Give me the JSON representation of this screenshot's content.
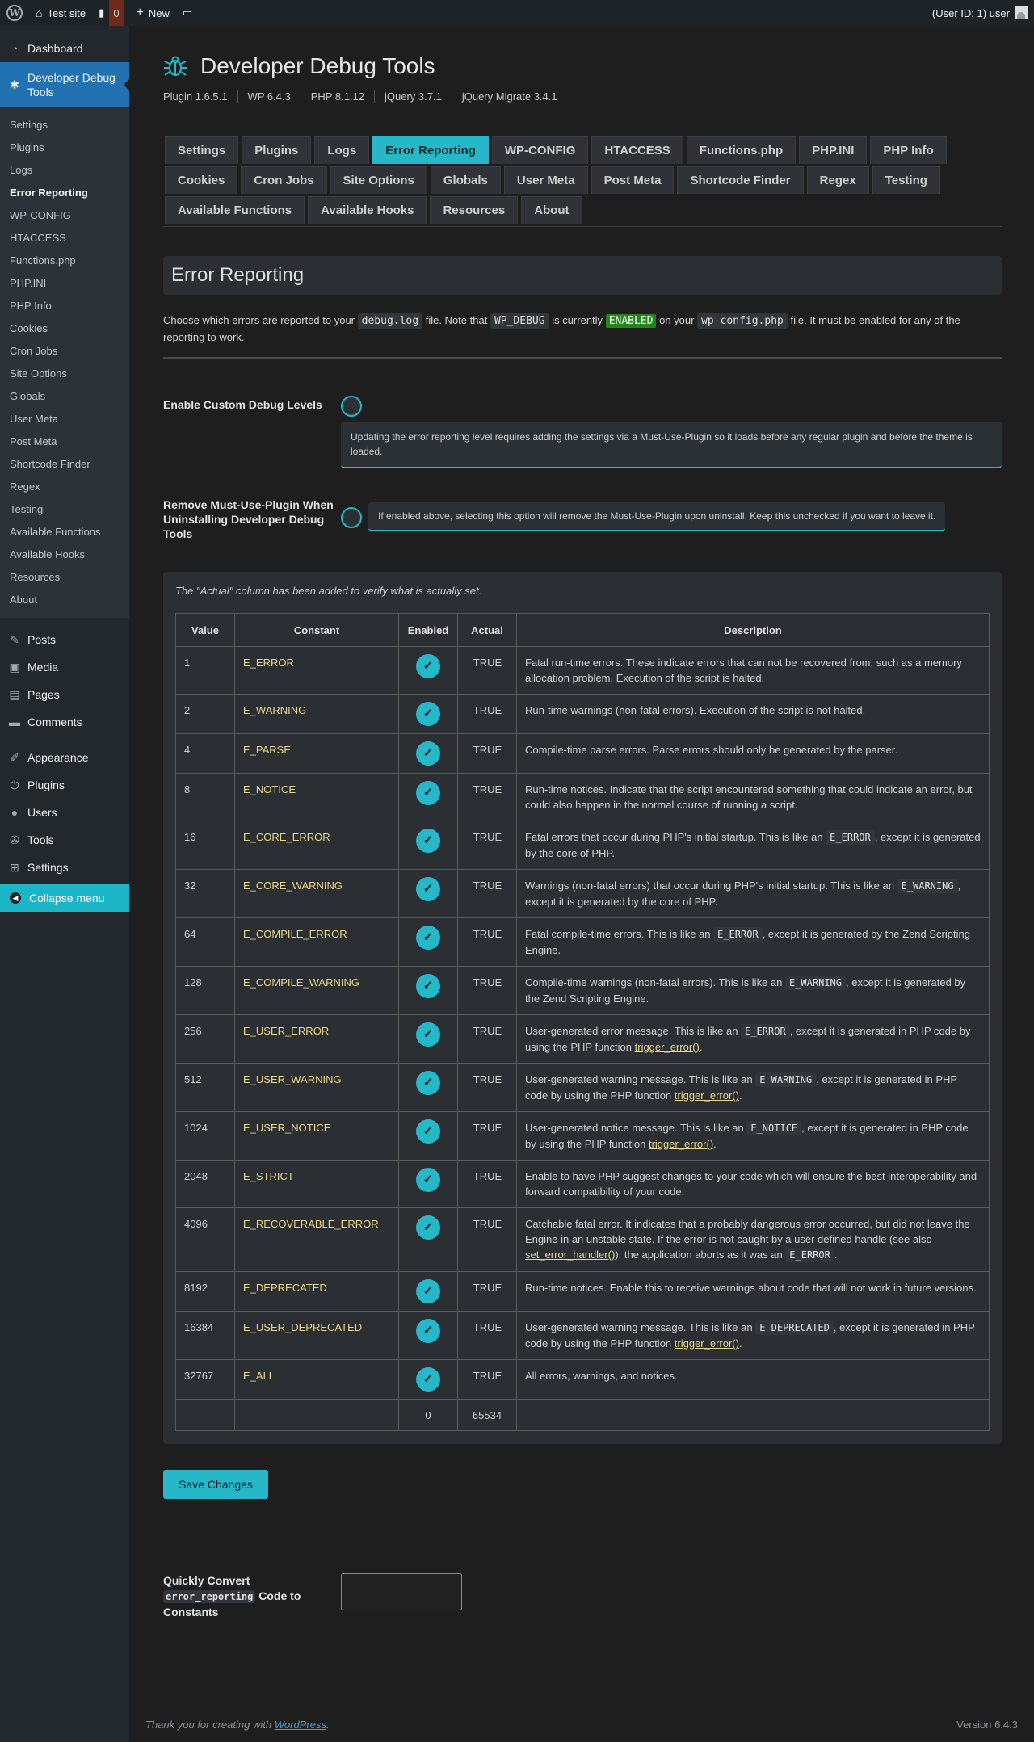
{
  "adminbar": {
    "site": "Test site",
    "comments_count": "0",
    "new": "New",
    "user": "(User ID: 1) user"
  },
  "sidebar": {
    "dashboard": "Dashboard",
    "plugin_menu": "Developer Debug Tools",
    "submenu": [
      "Settings",
      "Plugins",
      "Logs",
      "Error Reporting",
      "WP-CONFIG",
      "HTACCESS",
      "Functions.php",
      "PHP.INI",
      "PHP Info",
      "Cookies",
      "Cron Jobs",
      "Site Options",
      "Globals",
      "User Meta",
      "Post Meta",
      "Shortcode Finder",
      "Regex",
      "Testing",
      "Available Functions",
      "Available Hooks",
      "Resources",
      "About"
    ],
    "menu": {
      "posts": "Posts",
      "media": "Media",
      "pages": "Pages",
      "comments": "Comments",
      "appearance": "Appearance",
      "plugins": "Plugins",
      "users": "Users",
      "tools": "Tools",
      "settings": "Settings"
    },
    "collapse": "Collapse menu"
  },
  "header": {
    "title": "Developer Debug Tools",
    "versions": [
      "Plugin 1.6.5.1",
      "WP 6.4.3",
      "PHP 8.1.12",
      "jQuery 3.7.1",
      "jQuery Migrate 3.4.1"
    ]
  },
  "tabs": [
    "Settings",
    "Plugins",
    "Logs",
    "Error Reporting",
    "WP-CONFIG",
    "HTACCESS",
    "Functions.php",
    "PHP.INI",
    "PHP Info",
    "Cookies",
    "Cron Jobs",
    "Site Options",
    "Globals",
    "User Meta",
    "Post Meta",
    "Shortcode Finder",
    "Regex",
    "Testing",
    "Available Functions",
    "Available Hooks",
    "Resources",
    "About"
  ],
  "active_tab": "Error Reporting",
  "section_title": "Error Reporting",
  "intro": {
    "p1": "Choose which errors are reported to your",
    "code1": "debug.log",
    "p2": "file. Note that",
    "code2": "WP_DEBUG",
    "p3": "is currently",
    "status": "ENABLED",
    "p4": "on your",
    "code3": "wp-config.php",
    "p5": "file. It must be enabled for any of the reporting to work."
  },
  "fields": {
    "custom_levels_label": "Enable Custom Debug Levels",
    "custom_levels_notice": "Updating the error reporting level requires adding the settings via a Must-Use-Plugin so it loads before any regular plugin and before the theme is loaded.",
    "remove_mu_label": "Remove Must-Use-Plugin When Uninstalling Developer Debug Tools",
    "remove_mu_notice": "If enabled above, selecting this option will remove the Must-Use-Plugin upon uninstall. Keep this unchecked if you want to leave it."
  },
  "table": {
    "note": "The \"Actual\" column has been added to verify what is actually set.",
    "headers": {
      "value": "Value",
      "constant": "Constant",
      "enabled": "Enabled",
      "actual": "Actual",
      "description": "Description"
    },
    "check": "✓",
    "rows": [
      {
        "value": "1",
        "constant": "E_ERROR",
        "actual": "TRUE",
        "desc": [
          {
            "t": "Fatal run-time errors. These indicate errors that can not be recovered from, such as a memory allocation problem. Execution of the script is halted."
          }
        ]
      },
      {
        "value": "2",
        "constant": "E_WARNING",
        "actual": "TRUE",
        "desc": [
          {
            "t": "Run-time warnings (non-fatal errors). Execution of the script is not halted."
          }
        ]
      },
      {
        "value": "4",
        "constant": "E_PARSE",
        "actual": "TRUE",
        "desc": [
          {
            "t": "Compile-time parse errors. Parse errors should only be generated by the parser."
          }
        ]
      },
      {
        "value": "8",
        "constant": "E_NOTICE",
        "actual": "TRUE",
        "desc": [
          {
            "t": "Run-time notices. Indicate that the script encountered something that could indicate an error, but could also happen in the normal course of running a script."
          }
        ]
      },
      {
        "value": "16",
        "constant": "E_CORE_ERROR",
        "actual": "TRUE",
        "desc": [
          {
            "t": "Fatal errors that occur during PHP's initial startup. This is like an "
          },
          {
            "c": "E_ERROR"
          },
          {
            "t": ", except it is generated by the core of PHP."
          }
        ]
      },
      {
        "value": "32",
        "constant": "E_CORE_WARNING",
        "actual": "TRUE",
        "desc": [
          {
            "t": "Warnings (non-fatal errors) that occur during PHP's initial startup. This is like an "
          },
          {
            "c": "E_WARNING"
          },
          {
            "t": ", except it is generated by the core of PHP."
          }
        ]
      },
      {
        "value": "64",
        "constant": "E_COMPILE_ERROR",
        "actual": "TRUE",
        "desc": [
          {
            "t": "Fatal compile-time errors. This is like an "
          },
          {
            "c": "E_ERROR"
          },
          {
            "t": ", except it is generated by the Zend Scripting Engine."
          }
        ]
      },
      {
        "value": "128",
        "constant": "E_COMPILE_WARNING",
        "actual": "TRUE",
        "desc": [
          {
            "t": "Compile-time warnings (non-fatal errors). This is like an "
          },
          {
            "c": "E_WARNING"
          },
          {
            "t": ", except it is generated by the Zend Scripting Engine."
          }
        ]
      },
      {
        "value": "256",
        "constant": "E_USER_ERROR",
        "actual": "TRUE",
        "desc": [
          {
            "t": "User-generated error message. This is like an "
          },
          {
            "c": "E_ERROR"
          },
          {
            "t": ", except it is generated in PHP code by using the PHP function "
          },
          {
            "l": "trigger_error()"
          },
          {
            "t": "."
          }
        ]
      },
      {
        "value": "512",
        "constant": "E_USER_WARNING",
        "actual": "TRUE",
        "desc": [
          {
            "t": "User-generated warning message. This is like an "
          },
          {
            "c": "E_WARNING"
          },
          {
            "t": ", except it is generated in PHP code by using the PHP function "
          },
          {
            "l": "trigger_error()"
          },
          {
            "t": "."
          }
        ]
      },
      {
        "value": "1024",
        "constant": "E_USER_NOTICE",
        "actual": "TRUE",
        "desc": [
          {
            "t": "User-generated notice message. This is like an "
          },
          {
            "c": "E_NOTICE"
          },
          {
            "t": ", except it is generated in PHP code by using the PHP function "
          },
          {
            "l": "trigger_error()"
          },
          {
            "t": "."
          }
        ]
      },
      {
        "value": "2048",
        "constant": "E_STRICT",
        "actual": "TRUE",
        "desc": [
          {
            "t": "Enable to have PHP suggest changes to your code which will ensure the best interoperability and forward compatibility of your code."
          }
        ]
      },
      {
        "value": "4096",
        "constant": "E_RECOVERABLE_ERROR",
        "actual": "TRUE",
        "desc": [
          {
            "t": "Catchable fatal error. It indicates that a probably dangerous error occurred, but did not leave the Engine in an unstable state. If the error is not caught by a user defined handle (see also "
          },
          {
            "l": "set_error_handler()"
          },
          {
            "t": "), the application aborts as it was an "
          },
          {
            "c": "E_ERROR"
          },
          {
            "t": "."
          }
        ]
      },
      {
        "value": "8192",
        "constant": "E_DEPRECATED",
        "actual": "TRUE",
        "desc": [
          {
            "t": "Run-time notices. Enable this to receive warnings about code that will not work in future versions."
          }
        ]
      },
      {
        "value": "16384",
        "constant": "E_USER_DEPRECATED",
        "actual": "TRUE",
        "desc": [
          {
            "t": "User-generated warning message. This is like an "
          },
          {
            "c": "E_DEPRECATED"
          },
          {
            "t": ", except it is generated in PHP code by using the PHP function "
          },
          {
            "l": "trigger_error()"
          },
          {
            "t": "."
          }
        ]
      },
      {
        "value": "32767",
        "constant": "E_ALL",
        "actual": "TRUE",
        "desc": [
          {
            "t": "All errors, warnings, and notices."
          }
        ]
      }
    ],
    "total_enabled": "0",
    "total_actual": "65534"
  },
  "save_button": "Save Changes",
  "convert": {
    "label_pre": "Quickly Convert",
    "label_code": "error_reporting",
    "label_post": "Code to Constants",
    "value": ""
  },
  "footer": {
    "thanks_pre": "Thank you for creating with",
    "link": "WordPress",
    "thanks_post": ".",
    "version": "Version 6.4.3"
  },
  "colors": {
    "accent": "#26b7c9",
    "admin_blue": "#2271b1",
    "enabled_green": "#1d8a16",
    "constant_yellow": "#e8d98a"
  }
}
